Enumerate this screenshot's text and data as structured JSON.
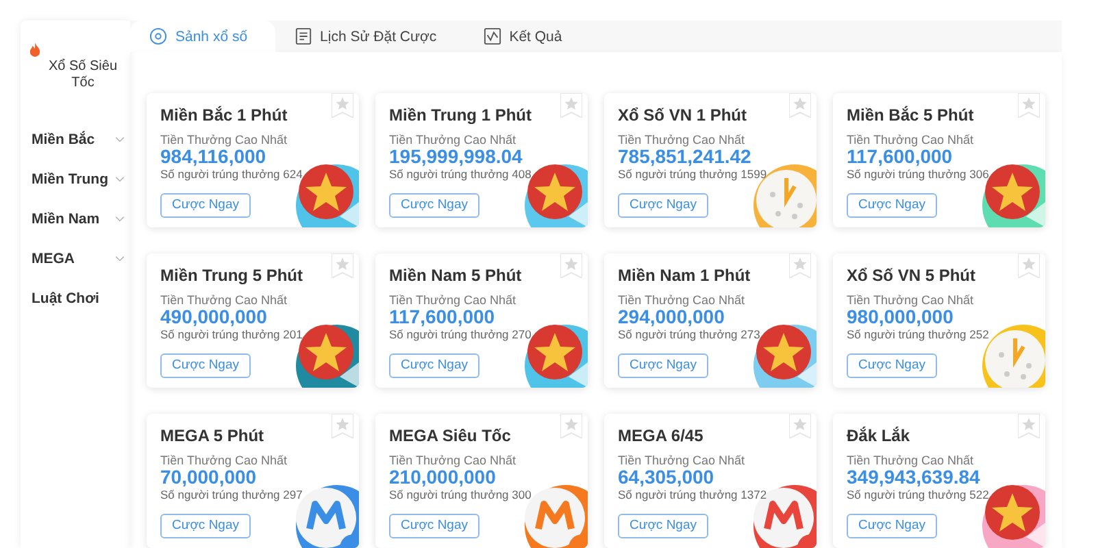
{
  "sidebar": {
    "heading": "Xổ Số Siêu Tốc",
    "items": [
      {
        "label": "Miền Bắc",
        "kind": "group"
      },
      {
        "label": "Miền Trung",
        "kind": "group"
      },
      {
        "label": "Miền Nam",
        "kind": "group"
      },
      {
        "label": "MEGA",
        "kind": "group"
      },
      {
        "label": "Luật Chơi",
        "kind": "link"
      }
    ]
  },
  "tabs": [
    {
      "label": "Sảnh xổ số",
      "selected": true
    },
    {
      "label": "Lịch Sử Đặt Cược",
      "selected": false
    },
    {
      "label": "Kết Quả",
      "selected": false
    }
  ],
  "games": [
    {
      "title": "Miền Bắc 1 Phút",
      "prize_label": "Tiền Thưởng Cao Nhất",
      "prize": "984,116,000",
      "winners": "Số người trúng thưởng 624",
      "button": "Cược Ngay",
      "kind": "star",
      "color": "#4fc3e8",
      "favorite": false
    },
    {
      "title": "Miền Trung 1 Phút",
      "prize_label": "Tiền Thưởng Cao Nhất",
      "prize": "195,999,998.04",
      "winners": "Số người trúng thưởng 408",
      "button": "Cược Ngay",
      "kind": "star",
      "color": "#5cc8ee",
      "favorite": false
    },
    {
      "title": "Xổ Số VN 1 Phút",
      "prize_label": "Tiền Thưởng Cao Nhất",
      "prize": "785,851,241.42",
      "winners": "Số người trúng thưởng 1599",
      "button": "Cược Ngay",
      "kind": "clock",
      "color": "#f6b23a",
      "favorite": false
    },
    {
      "title": "Miền Bắc 5 Phút",
      "prize_label": "Tiền Thưởng Cao Nhất",
      "prize": "117,600,000",
      "winners": "Số người trúng thưởng 306",
      "button": "Cược Ngay",
      "kind": "star",
      "color": "#5fdcb0",
      "favorite": false
    },
    {
      "title": "Miền Trung 5 Phút",
      "prize_label": "Tiền Thưởng Cao Nhất",
      "prize": "490,000,000",
      "winners": "Số người trúng thưởng 201",
      "button": "Cược Ngay",
      "kind": "star",
      "color": "#1f8aa0",
      "favorite": false
    },
    {
      "title": "Miền Nam 5 Phút",
      "prize_label": "Tiền Thưởng Cao Nhất",
      "prize": "117,600,000",
      "winners": "Số người trúng thưởng 270",
      "button": "Cược Ngay",
      "kind": "star",
      "color": "#4fc3e8",
      "favorite": false
    },
    {
      "title": "Miền Nam 1 Phút",
      "prize_label": "Tiền Thưởng Cao Nhất",
      "prize": "294,000,000",
      "winners": "Số người trúng thưởng 273",
      "button": "Cược Ngay",
      "kind": "star",
      "color": "#7ccdf0",
      "favorite": false
    },
    {
      "title": "Xổ Số VN 5 Phút",
      "prize_label": "Tiền Thưởng Cao Nhất",
      "prize": "980,000,000",
      "winners": "Số người trúng thưởng 252",
      "button": "Cược Ngay",
      "kind": "clock",
      "color": "#f7c21c",
      "favorite": false
    },
    {
      "title": "MEGA 5 Phút",
      "prize_label": "Tiền Thưởng Cao Nhất",
      "prize": "70,000,000",
      "winners": "Số người trúng thưởng 297",
      "button": "Cược Ngay",
      "kind": "mega",
      "color": "#3a8ee6",
      "favorite": false
    },
    {
      "title": "MEGA Siêu Tốc",
      "prize_label": "Tiền Thưởng Cao Nhất",
      "prize": "210,000,000",
      "winners": "Số người trúng thưởng 300",
      "button": "Cược Ngay",
      "kind": "mega",
      "color": "#f5791f",
      "favorite": false
    },
    {
      "title": "MEGA 6/45",
      "prize_label": "Tiền Thưởng Cao Nhất",
      "prize": "64,305,000",
      "winners": "Số người trúng thưởng 1372",
      "button": "Cược Ngay",
      "kind": "mega",
      "color": "#e8463c",
      "favorite": false
    },
    {
      "title": "Đắk Lắk",
      "prize_label": "Tiền Thưởng Cao Nhất",
      "prize": "349,943,639.84",
      "winners": "Số người trúng thưởng 522",
      "button": "Cược Ngay",
      "kind": "star",
      "color": "#f7a6c4",
      "favorite": false
    }
  ]
}
